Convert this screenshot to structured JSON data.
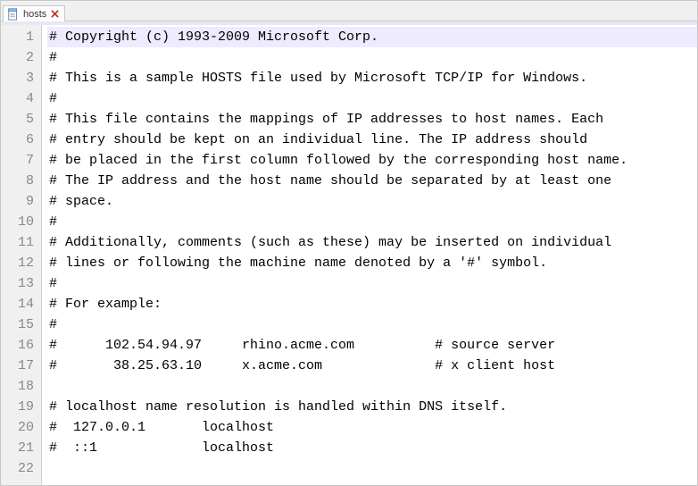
{
  "tab": {
    "label": "hosts",
    "close_tooltip": "Close"
  },
  "lines": [
    "# Copyright (c) 1993-2009 Microsoft Corp.",
    "#",
    "# This is a sample HOSTS file used by Microsoft TCP/IP for Windows.",
    "#",
    "# This file contains the mappings of IP addresses to host names. Each",
    "# entry should be kept on an individual line. The IP address should",
    "# be placed in the first column followed by the corresponding host name.",
    "# The IP address and the host name should be separated by at least one",
    "# space.",
    "#",
    "# Additionally, comments (such as these) may be inserted on individual",
    "# lines or following the machine name denoted by a '#' symbol.",
    "#",
    "# For example:",
    "#",
    "#      102.54.94.97     rhino.acme.com          # source server",
    "#       38.25.63.10     x.acme.com              # x client host",
    "",
    "# localhost name resolution is handled within DNS itself.",
    "#  127.0.0.1       localhost",
    "#  ::1             localhost",
    ""
  ]
}
